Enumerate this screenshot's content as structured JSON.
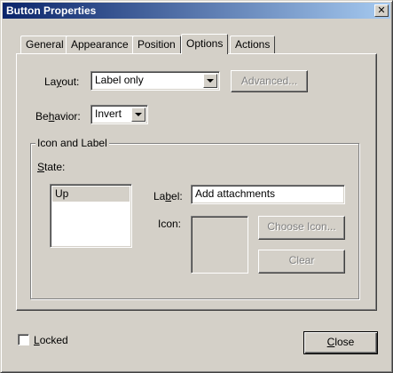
{
  "window": {
    "title": "Button Properties",
    "close_glyph": "✕"
  },
  "tabs": [
    {
      "label": "General"
    },
    {
      "label": "Appearance"
    },
    {
      "label": "Position"
    },
    {
      "label": "Options"
    },
    {
      "label": "Actions"
    }
  ],
  "options": {
    "layout": {
      "label_prefix": "La",
      "label_underline": "y",
      "label_suffix": "out:",
      "value": "Label only"
    },
    "advanced_button": "Advanced...",
    "behavior": {
      "label_prefix": "Be",
      "label_underline": "h",
      "label_suffix": "avior:",
      "value": "Invert"
    },
    "group": {
      "title": "Icon and Label",
      "state": {
        "label_underline": "S",
        "label_suffix": "tate:",
        "items": [
          "Up"
        ]
      },
      "label_field": {
        "label_prefix": "La",
        "label_underline": "b",
        "label_suffix": "el:",
        "value": "Add attachments"
      },
      "icon_label": "Icon:",
      "choose_icon_button": "Choose Icon...",
      "clear_button": "Clear"
    }
  },
  "footer": {
    "locked": {
      "label_underline": "L",
      "label_suffix": "ocked",
      "checked": false
    },
    "close_button": {
      "label_underline": "C",
      "label_suffix": "lose"
    }
  }
}
